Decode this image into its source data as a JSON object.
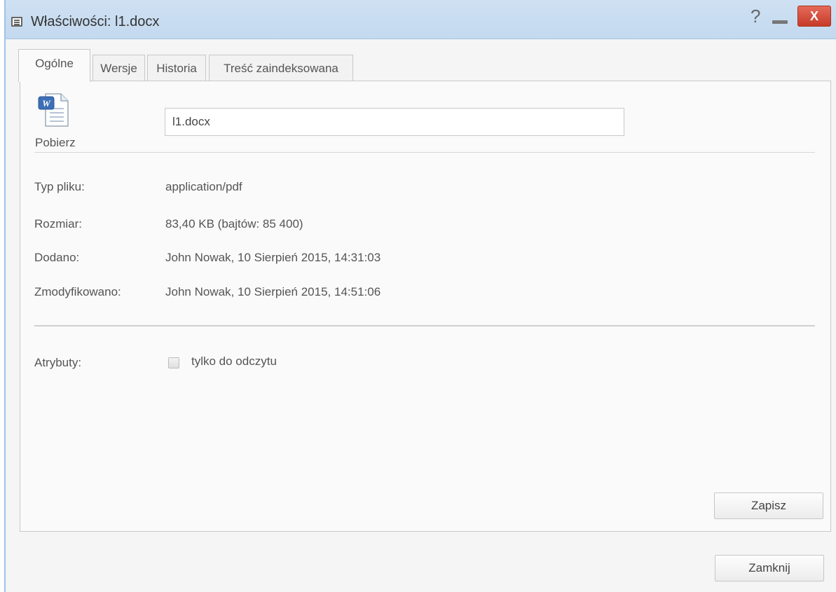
{
  "window": {
    "title": "Właściwości: l1.docx",
    "help_label": "?",
    "close_label": "X"
  },
  "tabs": [
    {
      "label": "Ogólne",
      "active": true
    },
    {
      "label": "Wersje",
      "active": false
    },
    {
      "label": "Historia",
      "active": false
    },
    {
      "label": "Treść zaindeksowana",
      "active": false
    }
  ],
  "general": {
    "download_label": "Pobierz",
    "file_name_value": "l1.docx",
    "fields": [
      {
        "label": "Typ pliku:",
        "value": "application/pdf"
      },
      {
        "label": "Rozmiar:",
        "value": "83,40 KB (bajtów: 85 400)"
      },
      {
        "label": "Dodano:",
        "value": "John Nowak, 10 Sierpień 2015, 14:31:03"
      },
      {
        "label": "Zmodyfikowano:",
        "value": "John Nowak, 10 Sierpień 2015, 14:51:06"
      }
    ],
    "attributes_label": "Atrybuty:",
    "readonly_label": "tylko do odczytu",
    "readonly_checked": false,
    "save_label": "Zapisz"
  },
  "footer": {
    "close_label": "Zamknij"
  },
  "icons": {
    "title": "properties-icon",
    "document": "word-document-icon"
  },
  "colors": {
    "titlebar": "#c9ddf1",
    "close_button": "#d64a36"
  }
}
